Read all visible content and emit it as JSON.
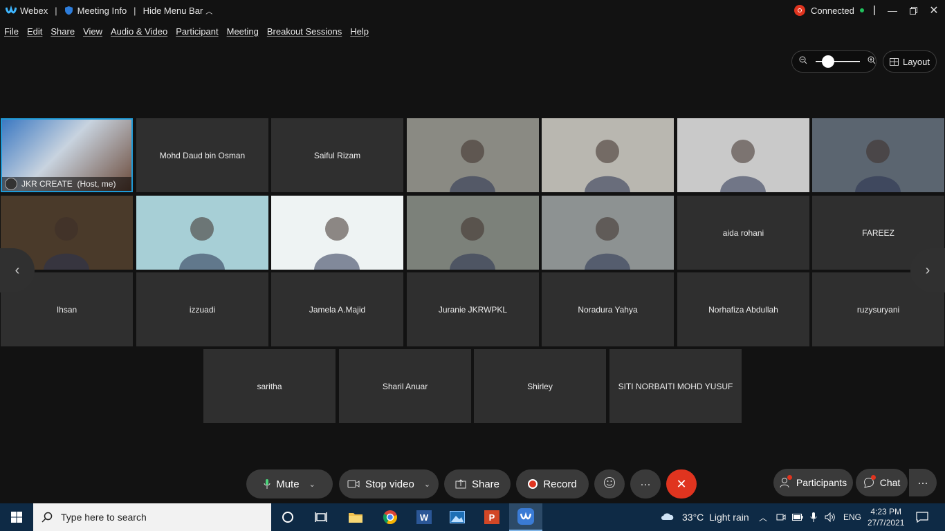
{
  "titlebar": {
    "app": "Webex",
    "meeting_info": "Meeting Info",
    "hide_menu": "Hide Menu Bar",
    "status": "Connected"
  },
  "menu": [
    "File",
    "Edit",
    "Share",
    "View",
    "Audio & Video",
    "Participant",
    "Meeting",
    "Breakout Sessions",
    "Help"
  ],
  "layout_label": "Layout",
  "zoom_fraction": 0.2,
  "tiles": [
    {
      "name": "JKR CREATE  (Host, me)",
      "video": true,
      "self": true
    },
    {
      "name": "Mohd Daud bin Osman"
    },
    {
      "name": "Saiful Rizam"
    },
    {
      "name": "",
      "video": true,
      "bg": "#8a8a83"
    },
    {
      "name": "",
      "video": true,
      "bg": "#b9b7b0"
    },
    {
      "name": "",
      "video": true,
      "bg": "#c9c9c9"
    },
    {
      "name": "",
      "video": true,
      "bg": "#5b6570"
    },
    {
      "name": "",
      "video": true,
      "bg": "#4a3a2a"
    },
    {
      "name": "",
      "video": true,
      "bg": "#a7cfd6"
    },
    {
      "name": "",
      "video": true,
      "bg": "#eef3f3"
    },
    {
      "name": "",
      "video": true,
      "bg": "#7c817a"
    },
    {
      "name": "",
      "video": true,
      "bg": "#8d9292"
    },
    {
      "name": "aida rohani"
    },
    {
      "name": "FAREEZ"
    },
    {
      "name": "Ihsan"
    },
    {
      "name": "izzuadi"
    },
    {
      "name": "Jamela A.Majid"
    },
    {
      "name": "Juranie JKRWPKL"
    },
    {
      "name": "Noradura Yahya"
    },
    {
      "name": "Norhafiza Abdullah"
    },
    {
      "name": "ruzysuryani"
    },
    {
      "name": "saritha"
    },
    {
      "name": "Sharil Anuar"
    },
    {
      "name": "Shirley"
    },
    {
      "name": "SITI NORBAITI MOHD YUSUF"
    }
  ],
  "controls": {
    "mute": "Mute",
    "stop_video": "Stop video",
    "share": "Share",
    "record": "Record",
    "participants": "Participants",
    "chat": "Chat"
  },
  "taskbar": {
    "search_placeholder": "Type here to search",
    "weather": "33°C  Light rain",
    "lang": "ENG",
    "time": "4:23 PM",
    "date": "27/7/2021"
  },
  "colors": {
    "accent": "#1f9bd8",
    "end_call": "#e0341f",
    "connected": "#21c15d",
    "taskbar": "#0e2a45"
  }
}
